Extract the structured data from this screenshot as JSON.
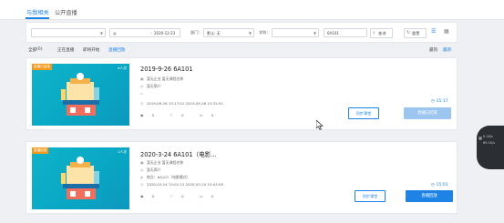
{
  "tabs": [
    {
      "label": "与我相关"
    },
    {
      "label": "公开直播"
    }
  ],
  "filters": {
    "date_start_placeholder": "",
    "date_separator": "-",
    "date_end": "2020-12-23",
    "dept_label": "部门：",
    "dept_value": "默认: 无",
    "subject_label": "学科：",
    "keyword_value": "6A101",
    "search_label": "查询",
    "reset_label": "重置"
  },
  "subfilters": [
    {
      "label": "全部"
    },
    {
      "label": "(0)"
    },
    {
      "label": "正在直播"
    },
    {
      "label": "即将开始"
    },
    {
      "label": "直播回放"
    }
  ],
  "sort": {
    "hottest": "最热",
    "newest": "最新"
  },
  "cards": [
    {
      "badge": "直播已结束",
      "viewers": "4人次",
      "title": "2019-9-26 6A101",
      "meta1": "暂无企业  暂无课程名称",
      "meta2": "暂无简介",
      "meta3": "",
      "time_range": "2019-09-26 15:17:01  2019-09-26 15:32:51",
      "stats": [
        "0",
        "0",
        "0"
      ],
      "duration": "15:17",
      "btn_sync": "同步课堂",
      "btn_main": "直播已结束"
    },
    {
      "badge": "直播回放",
      "viewers": "1人次",
      "title": "2020-3-24 6A101（电影...",
      "meta1": "暂无企业  暂无课程名称",
      "meta2": "暂无简介",
      "meta3": "地点：6A101（电影模式）",
      "time_range": "2020-03-24 15:01:12  2020-03-24 15:03:58",
      "stats": [
        "0",
        "0",
        "0"
      ],
      "duration": "15:01",
      "btn_sync": "同步课堂",
      "btn_main": "直播回放"
    }
  ],
  "widget": {
    "line1": "0.1K/s",
    "line2": "69.1K/s"
  },
  "colors": {
    "accent": "#1e83e5",
    "ended_badge": "#f39a1e",
    "replay_badge": "#f39a1e",
    "disabled_btn": "#9cc6ef"
  }
}
